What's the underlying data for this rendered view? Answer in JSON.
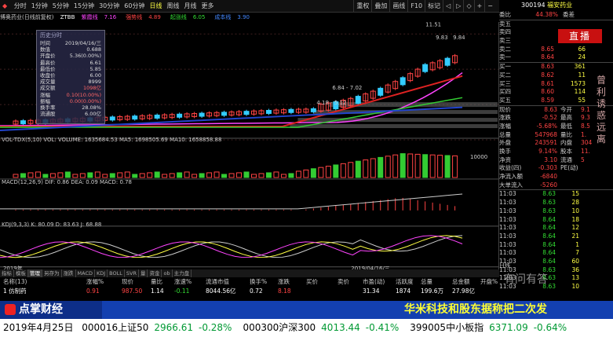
{
  "window": {
    "stock_label": "博奥药业(日线前复权)",
    "indicator": "ZTBB",
    "ma_items": [
      {
        "label": "紫霞线",
        "value": "7.16",
        "color": "#f4f"
      },
      {
        "label": "强势线",
        "value": "4.89",
        "color": "#f44"
      },
      {
        "label": "起涨线",
        "value": "6.05",
        "color": "#3d3"
      },
      {
        "label": "成本线",
        "value": "3.90",
        "color": "#48f"
      }
    ]
  },
  "topbar": {
    "periods": [
      "分时",
      "1分钟",
      "5分钟",
      "15分钟",
      "30分钟",
      "60分钟",
      "日线",
      "周线",
      "月线",
      "更多"
    ],
    "active_period": "日线",
    "tools": [
      "重权",
      "叠加",
      "画线",
      "F10",
      "标记",
      "◁",
      "▷",
      "◇",
      "+",
      "−"
    ]
  },
  "info_box": {
    "title": "历史分时",
    "rows": [
      {
        "k": "时间",
        "v": "2019/04/16/三"
      },
      {
        "k": "数值",
        "v": "0.688"
      },
      {
        "k": "开盘价",
        "v": "5.36(0.00%)"
      },
      {
        "k": "最高价",
        "v": "6.61"
      },
      {
        "k": "最低价",
        "v": "5.85"
      },
      {
        "k": "收盘价",
        "v": "6.00"
      },
      {
        "k": "成交量",
        "v": "8999"
      },
      {
        "k": "成交额",
        "v": "1098亿"
      },
      {
        "k": "涨幅",
        "v": "0.10(10.00%)"
      },
      {
        "k": "振幅",
        "v": "0.00(0.00%)"
      },
      {
        "k": "换手率",
        "v": "28.08%"
      },
      {
        "k": "流通股",
        "v": "6.00亿"
      }
    ]
  },
  "chart_labels": {
    "price_hi": "11.51",
    "price_mid": "9.83",
    "price_mid2": "9.84",
    "label_a": "6.84 - 7.02",
    "label_b": "4.18 - 5.12"
  },
  "indicators": {
    "vol": "VOL-TDX(5,10)  VOL:  VOLUME: 1635684.53  MA5: 1698505.69  MA10: 1658858.88",
    "macd": "MACD(12,26,9)  DIF: 0.86  DEA: 0.09  MACD: 0.78",
    "kdj": "KDJ(9,3,3)  K: 80.09  D: 83.63  J: 68.88",
    "vol_axis": "10000",
    "date_label": "2019年",
    "date_mark": "2019/04/16/三"
  },
  "right_panel": {
    "code": "300194",
    "name": "福安药业",
    "weibi": {
      "label": "委比",
      "value": "44.38%",
      "extra": "委差"
    },
    "asks": [
      {
        "l": "卖五",
        "p": "",
        "v": ""
      },
      {
        "l": "卖四",
        "p": "",
        "v": ""
      },
      {
        "l": "卖三",
        "p": "",
        "v": ""
      },
      {
        "l": "卖二",
        "p": "8.65",
        "v": "66"
      },
      {
        "l": "卖一",
        "p": "8.64",
        "v": "24"
      }
    ],
    "bids": [
      {
        "l": "买一",
        "p": "8.63",
        "v": "361"
      },
      {
        "l": "买二",
        "p": "8.62",
        "v": "11"
      },
      {
        "l": "买三",
        "p": "8.61",
        "v": "1573"
      },
      {
        "l": "买四",
        "p": "8.60",
        "v": "114"
      },
      {
        "l": "买五",
        "p": "8.59",
        "v": "55"
      }
    ],
    "stats": [
      {
        "k": "现价",
        "v": "8.63",
        "k2": "今开",
        "v2": "9.1"
      },
      {
        "k": "涨跌",
        "v": "-0.52",
        "k2": "最高",
        "v2": "9.3"
      },
      {
        "k": "涨幅",
        "v": "-5.68%",
        "k2": "最低",
        "v2": "8.5"
      },
      {
        "k": "总量",
        "v": "547968",
        "k2": "量比",
        "v2": "1."
      },
      {
        "k": "外盘",
        "v": "243591",
        "k2": "内盘",
        "v2": "304"
      },
      {
        "k": "换手",
        "v": "9.14%",
        "k2": "股本",
        "v2": "11."
      },
      {
        "k": "净资",
        "v": "3.10",
        "k2": "流通",
        "v2": "5"
      },
      {
        "k": "收益(四)",
        "v": "-0.303",
        "k2": "PE(动)",
        "v2": ""
      },
      {
        "k": "净流入额",
        "v": "-6840",
        "k2": "",
        "v2": ""
      },
      {
        "k": "大单流入",
        "v": "-5260",
        "k2": "",
        "v2": ""
      }
    ],
    "ticks": [
      {
        "t": "11:03",
        "p": "8.63",
        "v": "15"
      },
      {
        "t": "11:03",
        "p": "8.63",
        "v": "28"
      },
      {
        "t": "11:03",
        "p": "8.63",
        "v": "10"
      },
      {
        "t": "11:03",
        "p": "8.64",
        "v": "18"
      },
      {
        "t": "11:03",
        "p": "8.64",
        "v": "12"
      },
      {
        "t": "11:03",
        "p": "8.64",
        "v": "21"
      },
      {
        "t": "11:03",
        "p": "8.64",
        "v": "1"
      },
      {
        "t": "11:03",
        "p": "8.64",
        "v": "7"
      },
      {
        "t": "11:03",
        "p": "8.64",
        "v": "60"
      },
      {
        "t": "11:03",
        "p": "8.63",
        "v": "36"
      },
      {
        "t": "11:03",
        "p": "8.63",
        "v": "13"
      },
      {
        "t": "11:03",
        "p": "8.63",
        "v": "10"
      }
    ],
    "live_badge": "直播",
    "vertical_text": "曾利诱惑远离"
  },
  "bottom_tabs": {
    "items": [
      "指标",
      "模板",
      "管理",
      "另存为",
      "涨跌",
      "MACD",
      "KDJ",
      "BOLL",
      "SVR",
      "量",
      "资金",
      "ob",
      "主力盘"
    ],
    "active": "管理",
    "days": "日线"
  },
  "table": {
    "headers": [
      "名称(13)",
      "涨幅%",
      "现价",
      "量比",
      "涨速%",
      "流通市值",
      "换手%",
      "涨跌",
      "买价",
      "卖价",
      "市盈(动)",
      "活跃度",
      "总量",
      "总金额",
      "开盘%"
    ],
    "row": [
      "1  仿制药",
      "0.91",
      "987.50",
      "1.14",
      "-0.11",
      "8044.56亿",
      "0.72",
      "8.18",
      "",
      "",
      "31.34",
      "1874",
      "199.6万",
      "27.98亿",
      ""
    ]
  },
  "broadcast": {
    "logo": "点掌财经",
    "headline": "华米科技和股东据称把二次发",
    "watermark": "有问有答"
  },
  "bottom_ticker": {
    "date": "2019年4月25日",
    "items": [
      {
        "code": "000016",
        "name": "上证50",
        "price": "2966.61",
        "chg": "-0.28%"
      },
      {
        "code": "000300",
        "name": "沪深300",
        "price": "4013.44",
        "chg": "-0.41%"
      },
      {
        "code": "399005",
        "name": "中小板指",
        "price": "6371.09",
        "chg": "-0.64%"
      }
    ]
  }
}
